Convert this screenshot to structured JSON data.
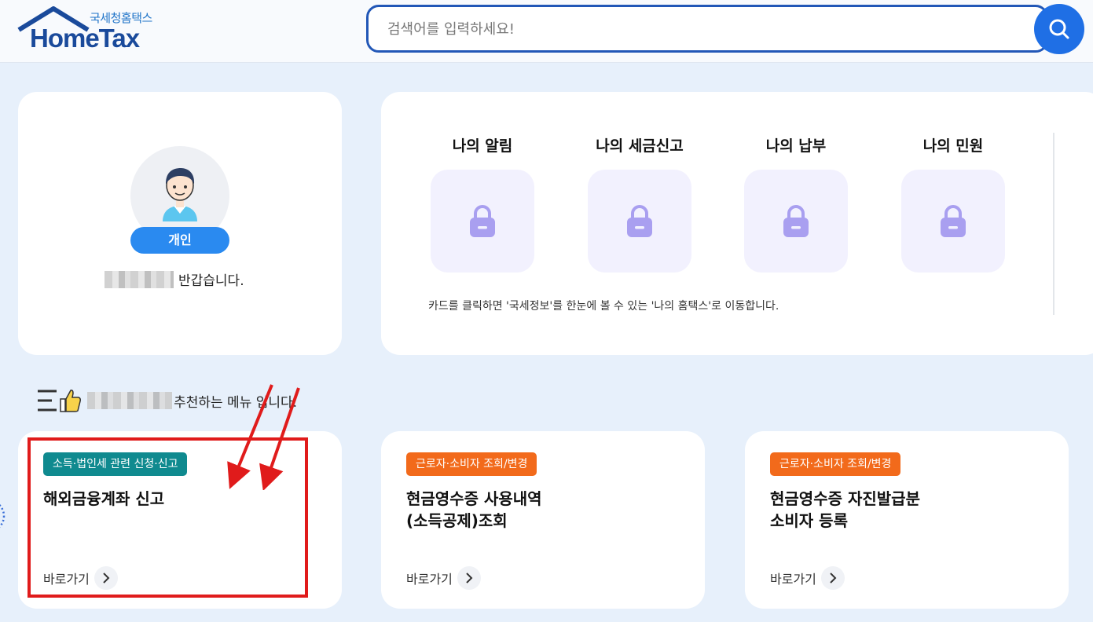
{
  "header": {
    "logo_sub": "국세청홈택스",
    "logo_main": "HomeTax",
    "search_placeholder": "검색어를 입력하세요!",
    "search_icon": "search-icon"
  },
  "profile": {
    "badge": "개인",
    "greeting_suffix": "반갑습니다."
  },
  "my_info": {
    "items": [
      {
        "title": "나의 알림",
        "icon": "lock-icon"
      },
      {
        "title": "나의 세금신고",
        "icon": "lock-icon"
      },
      {
        "title": "나의 납부",
        "icon": "lock-icon"
      },
      {
        "title": "나의 민원",
        "icon": "lock-icon"
      }
    ],
    "note": "카드를 클릭하면 '국세정보'를 한눈에 볼 수 있는 '나의 홈택스'로 이동합니다."
  },
  "recommend": {
    "suffix": "추천하는 메뉴 입니다."
  },
  "menus": [
    {
      "tag": "소득·법인세 관련 신청·신고",
      "tag_color": "#0f8a8f",
      "title": "해외금융계좌 신고",
      "go": "바로가기"
    },
    {
      "tag": "근로자·소비자 조회/변경",
      "tag_color": "#f26a1b",
      "title": "현금영수증 사용내역\n(소득공제)조회",
      "go": "바로가기"
    },
    {
      "tag": "근로자·소비자 조회/변경",
      "tag_color": "#f26a1b",
      "title": "현금영수증 자진발급분\n소비자 등록",
      "go": "바로가기"
    }
  ],
  "colors": {
    "accent": "#1f6fe5",
    "highlight": "#e01b1b",
    "background": "#e7f0fb"
  }
}
